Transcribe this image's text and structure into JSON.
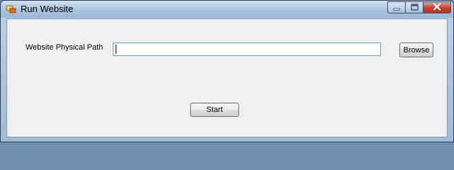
{
  "window": {
    "title": "Run Website",
    "icon": "application-icon",
    "controls": {
      "minimize": "minimize-icon",
      "maximize": "maximize-icon",
      "close": "close-icon"
    }
  },
  "form": {
    "path_label": "Website Physical Path",
    "path_value": "",
    "browse_label": "Browse",
    "start_label": "Start"
  },
  "colors": {
    "titlebar": "#a9c4e1",
    "client_bg": "#f0f0f0",
    "close_button": "#c2432a",
    "input_border": "#7a9cc0"
  }
}
